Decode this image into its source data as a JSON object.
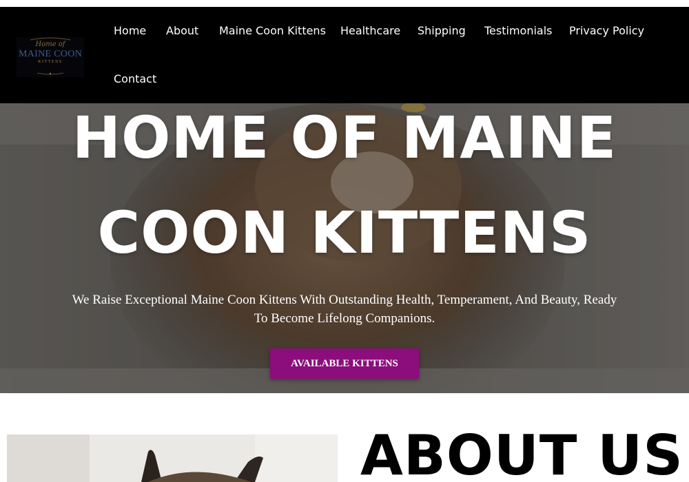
{
  "header": {
    "logo": {
      "line1": "Home of",
      "line2": "MAINE COON",
      "line3": "KITTENS"
    },
    "nav": [
      {
        "label": "Home"
      },
      {
        "label": "About"
      },
      {
        "label": "Maine Coon Kittens"
      },
      {
        "label": "Healthcare"
      },
      {
        "label": "Shipping"
      },
      {
        "label": "Testimonials"
      },
      {
        "label": "Privacy Policy"
      },
      {
        "label": "Contact"
      }
    ]
  },
  "hero": {
    "title_line1": "HOME OF MAINE",
    "title_line2": "COON KITTENS",
    "subtitle": "We Raise Exceptional Maine Coon Kittens With Outstanding Health, Temperament, And Beauty, Ready To Become Lifelong Companions.",
    "button_label": "AVAILABLE KITTENS"
  },
  "about": {
    "title": "ABOUT US"
  },
  "colors": {
    "header_bg": "#000000",
    "button_bg": "#8c0d7c",
    "text_light": "#ffffff"
  }
}
